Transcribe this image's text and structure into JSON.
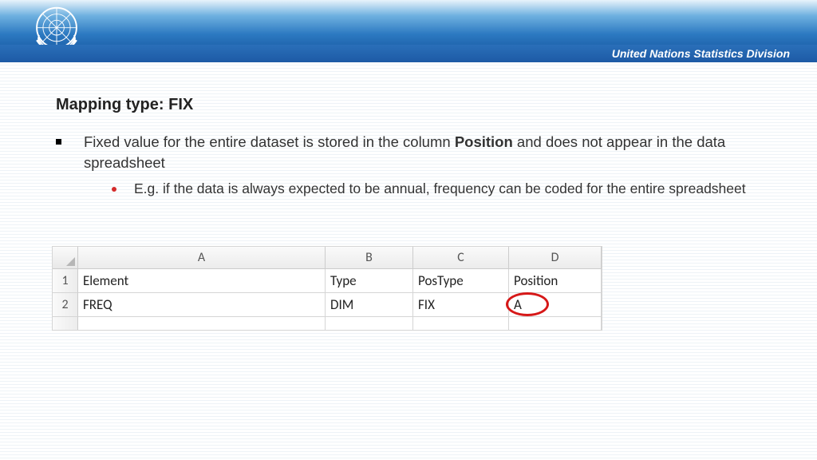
{
  "header": {
    "brand": "United Nations Statistics Division"
  },
  "title": "Mapping type: FIX",
  "bullet": {
    "prefix": "Fixed value for the entire dataset is stored in the column ",
    "bold": "Position",
    "suffix": " and does not appear in the data spreadsheet"
  },
  "sub_bullet": "E.g. if the data is always expected to be annual, frequency can be coded for the entire spreadsheet",
  "spreadsheet": {
    "cols": [
      "A",
      "B",
      "C",
      "D"
    ],
    "row_nums": [
      "1",
      "2"
    ],
    "rows": [
      [
        "Element",
        "Type",
        "PosType",
        "Position"
      ],
      [
        "FREQ",
        "DIM",
        "FIX",
        "A"
      ]
    ],
    "partial_row": [
      "",
      "",
      "",
      ""
    ],
    "highlight": {
      "row": 1,
      "col": 3
    }
  }
}
